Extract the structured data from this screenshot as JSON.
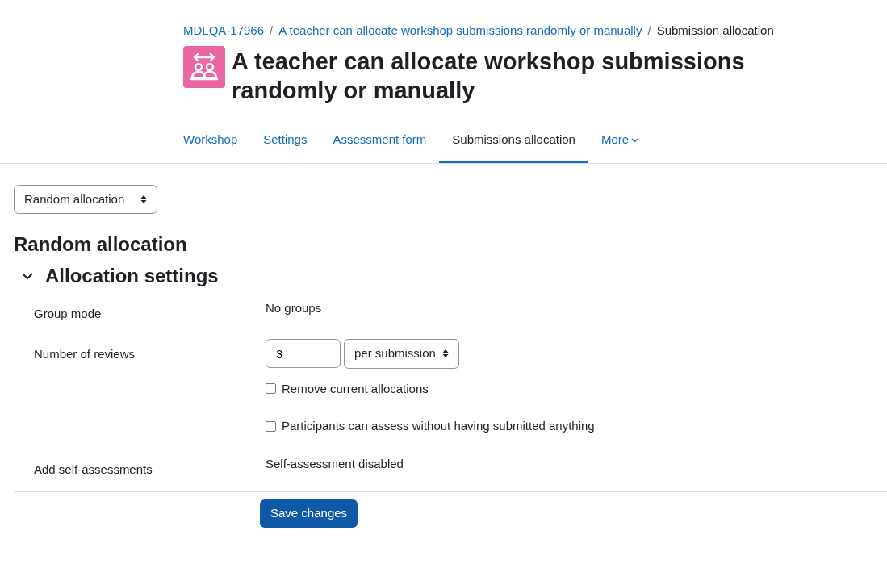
{
  "breadcrumb": [
    {
      "text": "MDLQA-17966",
      "kind": "link"
    },
    {
      "separator": "/",
      "text": "A teacher can allocate workshop submissions randomly or manually",
      "kind": "link"
    },
    {
      "separator": "/",
      "text": "Submission allocation",
      "kind": "current"
    }
  ],
  "page_title": "A teacher can allocate workshop submissions randomly or manually",
  "tabs": [
    {
      "label": "Workshop",
      "selected": false,
      "kind": "tab"
    },
    {
      "label": "Settings",
      "selected": false,
      "kind": "tab"
    },
    {
      "label": "Assessment form",
      "selected": false,
      "kind": "tab"
    },
    {
      "label": "Submissions allocation",
      "selected": true,
      "kind": "tab"
    },
    {
      "label": "More",
      "selected": false,
      "kind": "dropdown"
    }
  ],
  "method_select": {
    "value": "Random allocation"
  },
  "heading": "Random allocation",
  "section": {
    "title": "Allocation settings",
    "expanded": true,
    "rows": [
      {
        "kind": "static",
        "label": "Group mode",
        "value": "No groups"
      },
      {
        "kind": "number_unit",
        "label": "Number of reviews",
        "value": "3",
        "unit": "per submission"
      },
      {
        "kind": "checkbox",
        "text": "Remove current allocations",
        "checked": false
      },
      {
        "kind": "checkbox",
        "text": "Participants can assess without having submitted anything",
        "checked": false
      },
      {
        "kind": "static",
        "label": "Add self-assessments",
        "value": "Self-assessment disabled"
      }
    ]
  },
  "save_button": "Save changes"
}
